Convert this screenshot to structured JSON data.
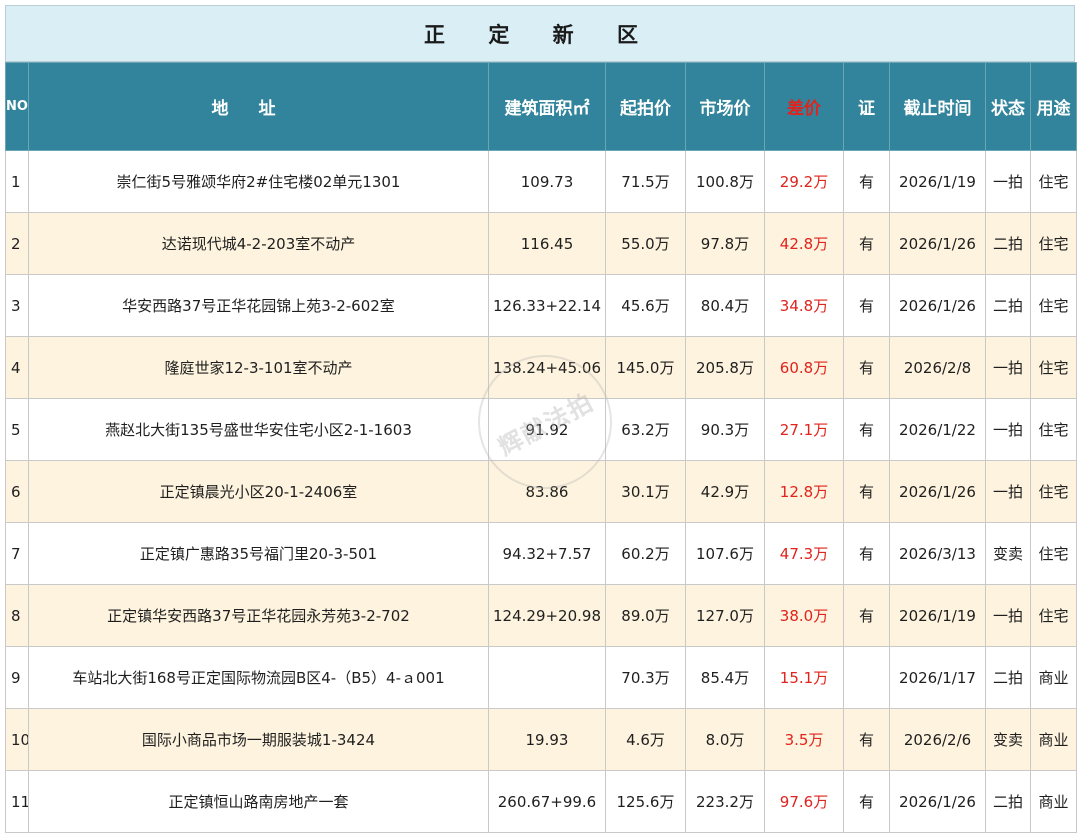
{
  "title": "正 定 新 区",
  "headers": {
    "no": "NO.",
    "address": "地址",
    "area": "建筑面积㎡",
    "start_price": "起拍价",
    "market_price": "市场价",
    "diff": "差价",
    "certificate": "证",
    "deadline": "截止时间",
    "status": "状态",
    "usage": "用途"
  },
  "rows": [
    {
      "no": "1",
      "address": "崇仁街5号雅颂华府2#住宅楼02单元1301",
      "area": "109.73",
      "start_price": "71.5万",
      "market_price": "100.8万",
      "diff": "29.2万",
      "certificate": "有",
      "deadline": "2026/1/19",
      "status": "一拍",
      "usage": "住宅"
    },
    {
      "no": "2",
      "address": "达诺现代城4-2-203室不动产",
      "area": "116.45",
      "start_price": "55.0万",
      "market_price": "97.8万",
      "diff": "42.8万",
      "certificate": "有",
      "deadline": "2026/1/26",
      "status": "二拍",
      "usage": "住宅"
    },
    {
      "no": "3",
      "address": "华安西路37号正华花园锦上苑3-2-602室",
      "area": "126.33+22.14",
      "start_price": "45.6万",
      "market_price": "80.4万",
      "diff": "34.8万",
      "certificate": "有",
      "deadline": "2026/1/26",
      "status": "二拍",
      "usage": "住宅"
    },
    {
      "no": "4",
      "address": "隆庭世家12-3-101室不动产",
      "area": "138.24+45.06",
      "start_price": "145.0万",
      "market_price": "205.8万",
      "diff": "60.8万",
      "certificate": "有",
      "deadline": "2026/2/8",
      "status": "一拍",
      "usage": "住宅"
    },
    {
      "no": "5",
      "address": "燕赵北大街135号盛世华安住宅小区2-1-1603",
      "area": "91.92",
      "start_price": "63.2万",
      "market_price": "90.3万",
      "diff": "27.1万",
      "certificate": "有",
      "deadline": "2026/1/22",
      "status": "一拍",
      "usage": "住宅"
    },
    {
      "no": "6",
      "address": "正定镇晨光小区20-1-2406室",
      "area": "83.86",
      "start_price": "30.1万",
      "market_price": "42.9万",
      "diff": "12.8万",
      "certificate": "有",
      "deadline": "2026/1/26",
      "status": "一拍",
      "usage": "住宅"
    },
    {
      "no": "7",
      "address": "正定镇广惠路35号福门里20-3-501",
      "area": "94.32+7.57",
      "start_price": "60.2万",
      "market_price": "107.6万",
      "diff": "47.3万",
      "certificate": "有",
      "deadline": "2026/3/13",
      "status": "变卖",
      "usage": "住宅"
    },
    {
      "no": "8",
      "address": "正定镇华安西路37号正华花园永芳苑3-2-702",
      "area": "124.29+20.98",
      "start_price": "89.0万",
      "market_price": "127.0万",
      "diff": "38.0万",
      "certificate": "有",
      "deadline": "2026/1/19",
      "status": "一拍",
      "usage": "住宅"
    },
    {
      "no": "9",
      "address": "车站北大街168号正定国际物流园B区4-（B5）4-ａ001",
      "area": "",
      "start_price": "70.3万",
      "market_price": "85.4万",
      "diff": "15.1万",
      "certificate": "",
      "deadline": "2026/1/17",
      "status": "二拍",
      "usage": "商业"
    },
    {
      "no": "10",
      "address": "国际小商品市场一期服装城1-3424",
      "area": "19.93",
      "start_price": "4.6万",
      "market_price": "8.0万",
      "diff": "3.5万",
      "certificate": "有",
      "deadline": "2026/2/6",
      "status": "变卖",
      "usage": "商业"
    },
    {
      "no": "11",
      "address": "正定镇恒山路南房地产一套",
      "area": "260.67+99.6",
      "start_price": "125.6万",
      "market_price": "223.2万",
      "diff": "97.6万",
      "certificate": "有",
      "deadline": "2026/1/26",
      "status": "二拍",
      "usage": "商业"
    }
  ],
  "watermark": "辉献法拍",
  "colors": {
    "header_bg": "#31849b",
    "title_bg": "#d9eef5",
    "even_row_bg": "#fdf3de",
    "diff_text": "#e0231d"
  }
}
